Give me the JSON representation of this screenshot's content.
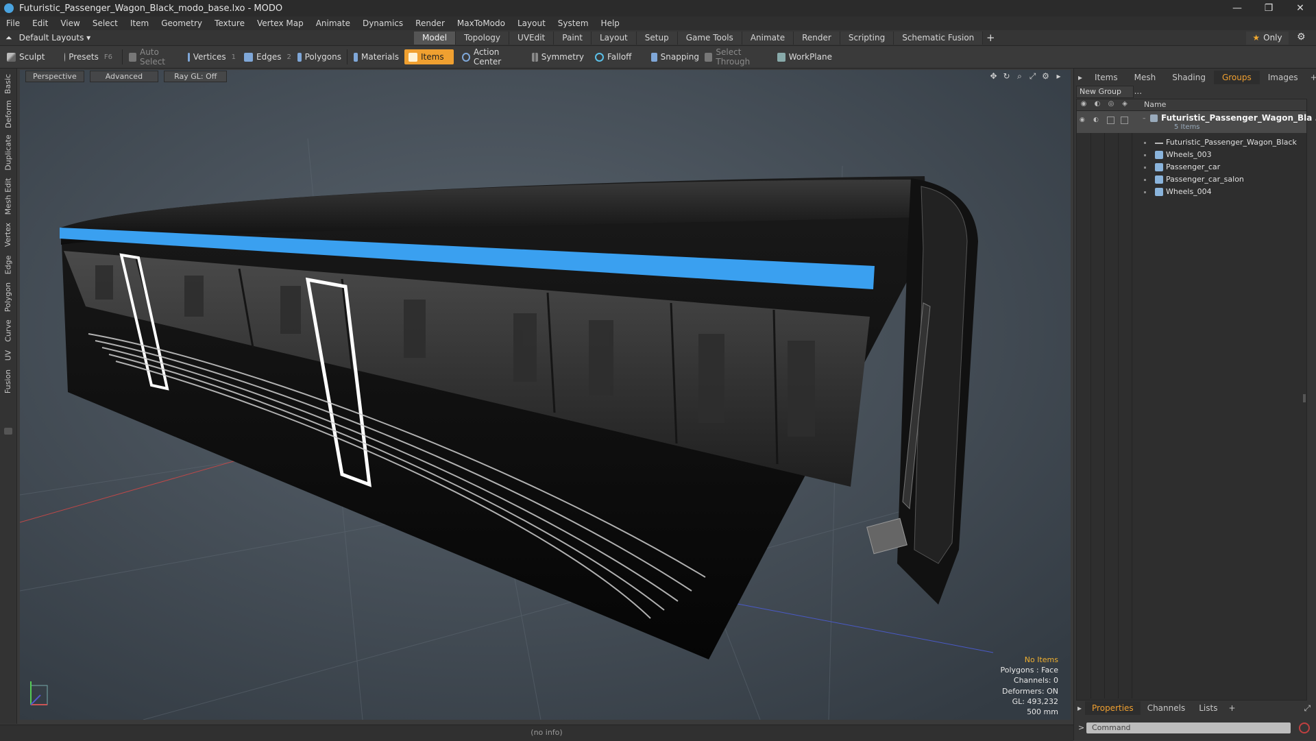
{
  "window": {
    "title": "Futuristic_Passenger_Wagon_Black_modo_base.lxo - MODO",
    "controls": [
      "—",
      "❐",
      "✕"
    ]
  },
  "menu": [
    "File",
    "Edit",
    "View",
    "Select",
    "Item",
    "Geometry",
    "Texture",
    "Vertex Map",
    "Animate",
    "Dynamics",
    "Render",
    "MaxToModo",
    "Layout",
    "System",
    "Help"
  ],
  "layout_bar": {
    "layout_select": "Default Layouts ▾",
    "tabs": [
      "Model",
      "Topology",
      "UVEdit",
      "Paint",
      "Layout",
      "Setup",
      "Game Tools",
      "Animate",
      "Render",
      "Scripting",
      "Schematic Fusion"
    ],
    "active_tab": "Model",
    "plus": "+",
    "only_label": "Only"
  },
  "toolbar": {
    "sculpt": "Sculpt",
    "presets": "Presets",
    "presets_key": "F6",
    "auto_select": "Auto Select",
    "vertices": "Vertices",
    "vertices_key": "1",
    "edges": "Edges",
    "edges_key": "2",
    "polygons": "Polygons",
    "materials": "Materials",
    "items": "Items",
    "action_center": "Action Center",
    "symmetry": "Symmetry",
    "falloff": "Falloff",
    "snapping": "Snapping",
    "select_through": "Select Through",
    "workplane": "WorkPlane"
  },
  "left_tabs": [
    "Basic",
    "Deform",
    "Duplicate",
    "Mesh Edit",
    "Vertex",
    "Edge",
    "Polygon",
    "Curve",
    "UV",
    "Fusion"
  ],
  "viewport": {
    "buttons": [
      "Perspective",
      "Advanced",
      "Ray GL: Off"
    ],
    "info": {
      "warning": "No Items",
      "polygons": "Polygons : Face",
      "channels": "Channels: 0",
      "deformers": "Deformers: ON",
      "gl": "GL: 493,232",
      "scale": "500 mm"
    }
  },
  "status": {
    "text": "(no info)"
  },
  "right_panel": {
    "tabs": [
      "Items",
      "Mesh ...",
      "Shading",
      "Groups",
      "Images"
    ],
    "active_tab": "Groups",
    "new_group": "New Group",
    "column_name": "Name",
    "group": {
      "name": "Futuristic_Passenger_Wagon_Bla ...",
      "count": "5 Items"
    },
    "items": [
      "Futuristic_Passenger_Wagon_Black",
      "Wheels_003",
      "Passenger_car",
      "Passenger_car_salon",
      "Wheels_004"
    ],
    "bottom_tabs": [
      "Properties",
      "Channels",
      "Lists"
    ],
    "bottom_active": "Properties",
    "command_placeholder": "Command"
  },
  "colors": {
    "accent": "#f0a030",
    "stripe": "#3aa0f0",
    "viewport_bg": "#46505a"
  }
}
